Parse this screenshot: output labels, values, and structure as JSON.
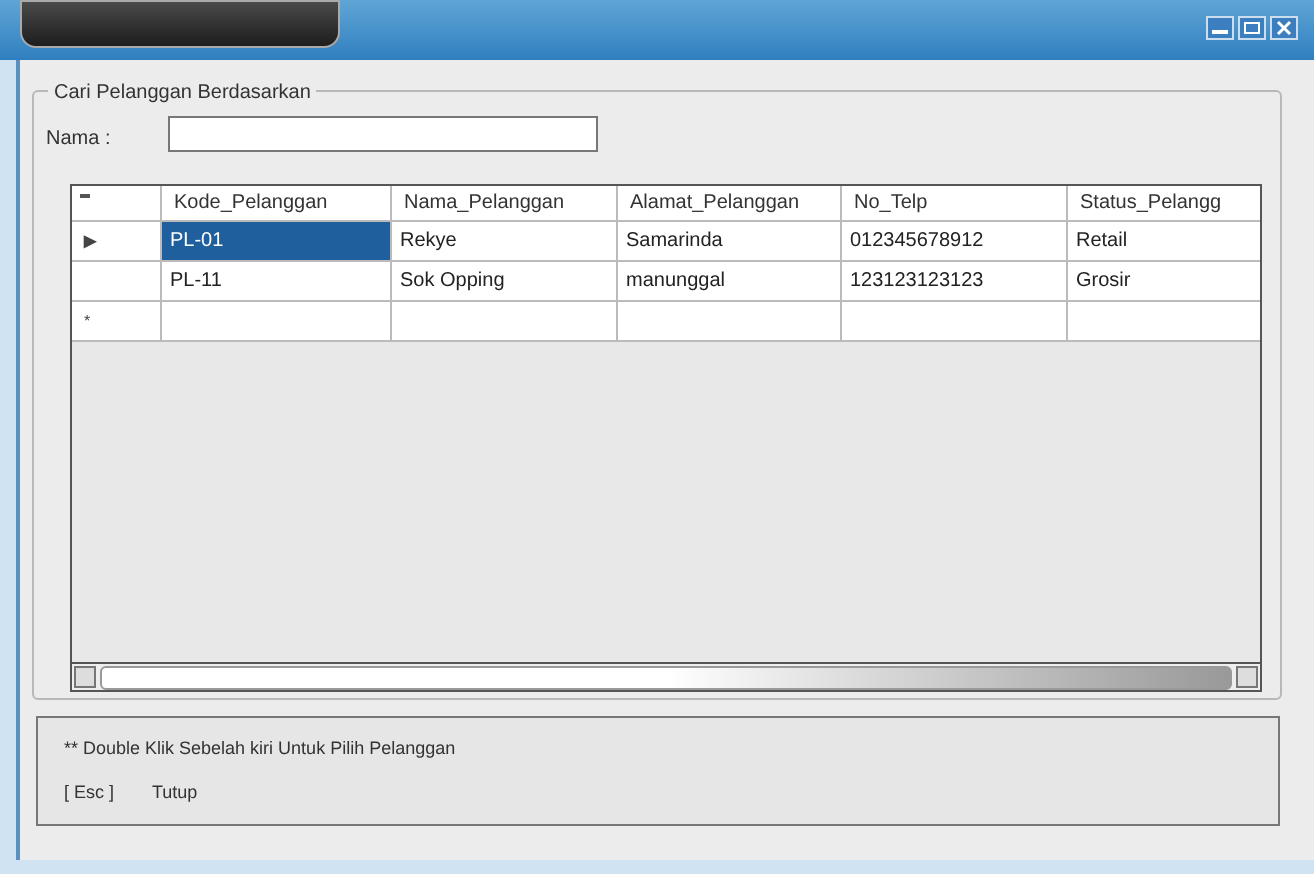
{
  "search_group": {
    "title": "Cari Pelanggan Berdasarkan",
    "field_label": "Nama :"
  },
  "table": {
    "columns": [
      "Kode_Pelanggan",
      "Nama_Pelanggan",
      "Alamat_Pelanggan",
      "No_Telp",
      "Status_Pelangg"
    ],
    "rows": [
      {
        "marker": "▶",
        "selected": true,
        "cells": [
          "PL-01",
          "Rekye",
          "Samarinda",
          "012345678912",
          "Retail"
        ]
      },
      {
        "marker": "",
        "selected": false,
        "cells": [
          "PL-11",
          "Sok Opping",
          "manunggal",
          "123123123123",
          "Grosir"
        ]
      },
      {
        "marker": "*",
        "selected": false,
        "cells": [
          "",
          "",
          "",
          "",
          ""
        ]
      }
    ]
  },
  "hint": {
    "note": "** Double Klik Sebelah kiri Untuk Pilih Pelanggan",
    "key": "[ Esc ]",
    "action": "Tutup"
  }
}
